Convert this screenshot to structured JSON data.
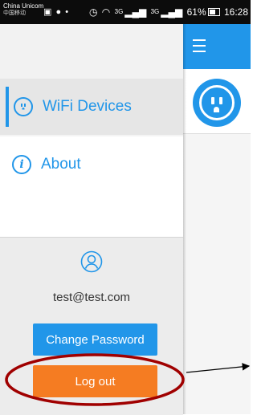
{
  "status_bar": {
    "carrier": "China Unicom",
    "carrier2": "中国移动",
    "network_label_1": "3G",
    "network_label_2": "3G",
    "battery": "61%",
    "time": "16:28"
  },
  "drawer": {
    "items": [
      {
        "label": "WiFi Devices",
        "icon": "wifi-device-icon",
        "active": true
      },
      {
        "label": "About",
        "icon": "info-icon",
        "active": false
      }
    ],
    "user": {
      "email": "test@test.com",
      "icon": "user-icon"
    },
    "buttons": {
      "change_password": "Change Password",
      "logout": "Log out"
    }
  },
  "content": {
    "menu_icon": "hamburger-icon",
    "device_icon": "power-outlet-icon"
  },
  "colors": {
    "accent": "#2196e9",
    "logout": "#f57c22",
    "annotation": "#a00000"
  }
}
